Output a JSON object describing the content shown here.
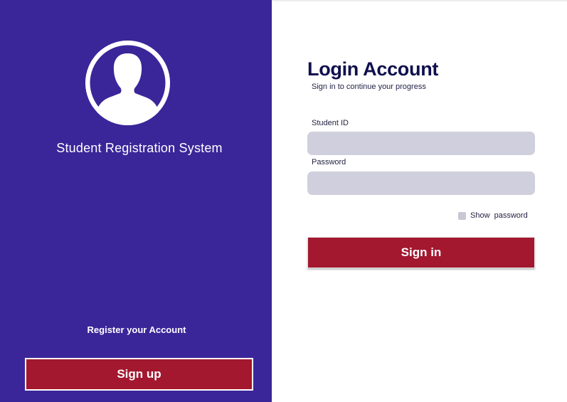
{
  "left_panel": {
    "system_title": "Student Registration System",
    "register_text": "Register your Account",
    "signup_label": "Sign up"
  },
  "login": {
    "title": "Login Account",
    "subtitle": "Sign in to continue your progress",
    "student_id_label": "Student ID",
    "student_id_value": "",
    "password_label": "Password",
    "password_value": "",
    "show_password_label": "Show  password",
    "signin_label": "Sign in"
  },
  "icons": {
    "avatar": "user-avatar-icon"
  },
  "colors": {
    "sidebar_bg": "#3a2699",
    "button_bg": "#a3172f",
    "input_bg": "#d0cfdd",
    "title_color": "#0f0f4d"
  }
}
